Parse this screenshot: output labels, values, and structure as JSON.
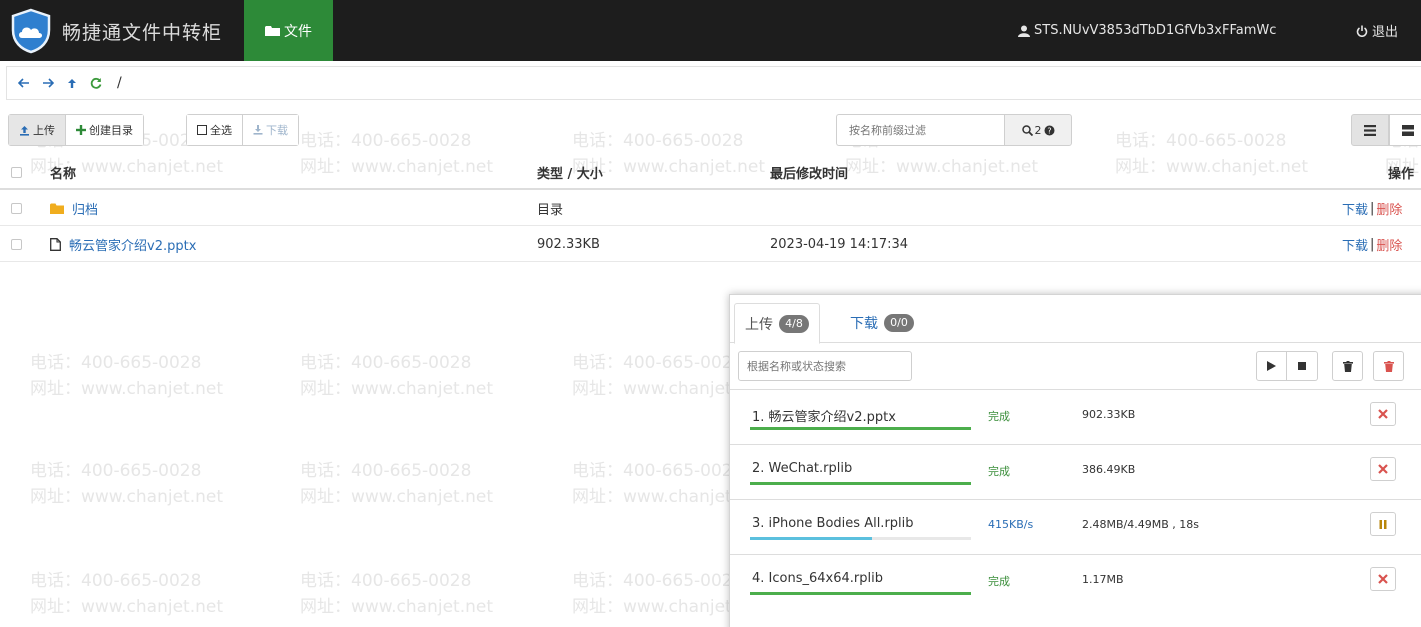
{
  "watermark": {
    "phone": "电话：400-665-0028",
    "site": "网址：www.chanjet.net"
  },
  "navbar": {
    "brand_title": "畅捷通文件中转柜",
    "file_tab_label": "文件",
    "user_label": "STS.NUvV3853dTbD1GfVb3xFFamWc",
    "logout_label": "退出"
  },
  "pathbar": {
    "path": "/"
  },
  "toolbar": {
    "upload_label": "上传",
    "mkdir_label": "创建目录",
    "select_all_label": "全选",
    "download_label": "下载",
    "search_placeholder": "按名称前缀过滤",
    "search_count": "2"
  },
  "file_table": {
    "headers": {
      "name": "名称",
      "type_size": "类型 / 大小",
      "modified": "最后修改时间",
      "actions": "操作"
    },
    "rows": [
      {
        "name": "归档",
        "type_size": "目录",
        "modified": "",
        "download": "下载",
        "delete": "删除",
        "kind": "folder"
      },
      {
        "name": "畅云管家介绍v2.pptx",
        "type_size": "902.33KB",
        "modified": "2023-04-19 14:17:34",
        "download": "下载",
        "delete": "删除",
        "kind": "file"
      }
    ]
  },
  "transfer_panel": {
    "upload_tab_label": "上传",
    "upload_badge": "4/8",
    "download_tab_label": "下载",
    "download_badge": "0/0",
    "search_placeholder": "根据名称或状态搜索",
    "items": [
      {
        "name": "1. 畅云管家介绍v2.pptx",
        "status": "完成",
        "size": "902.33KB",
        "progress": 1.0,
        "bar_color": "#4cae4c",
        "action": "remove"
      },
      {
        "name": "2. WeChat.rplib",
        "status": "完成",
        "size": "386.49KB",
        "progress": 1.0,
        "bar_color": "#4cae4c",
        "action": "remove"
      },
      {
        "name": "3. iPhone Bodies All.rplib",
        "status": "415KB/s",
        "size": "2.48MB/4.49MB , 18s",
        "progress": 0.55,
        "bar_color": "#5bc0de",
        "action": "pause"
      },
      {
        "name": "4. Icons_64x64.rplib",
        "status": "完成",
        "size": "1.17MB",
        "progress": 1.0,
        "bar_color": "#4cae4c",
        "action": "remove"
      }
    ]
  },
  "colors": {
    "navbar_bg": "#1d1d1d",
    "active_nav": "#2d8a38",
    "link": "#2a6db5",
    "danger": "#d9534f",
    "success": "#4cae4c"
  }
}
